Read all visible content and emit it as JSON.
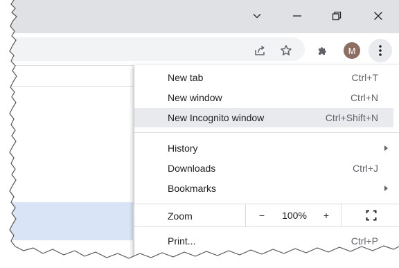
{
  "window": {
    "controls": [
      "tab-search-icon",
      "minimize-icon",
      "restore-icon",
      "close-icon"
    ]
  },
  "toolbar": {
    "icons": [
      "share-icon",
      "bookmark-star-icon",
      "extensions-icon"
    ],
    "avatar_letter": "M",
    "menu_icon": "kebab-menu-icon"
  },
  "menu": {
    "items": [
      {
        "label": "New tab",
        "shortcut": "Ctrl+T"
      },
      {
        "label": "New window",
        "shortcut": "Ctrl+N"
      },
      {
        "label": "New Incognito window",
        "shortcut": "Ctrl+Shift+N",
        "highlighted": true
      },
      {
        "label": "History",
        "submenu": true
      },
      {
        "label": "Downloads",
        "shortcut": "Ctrl+J"
      },
      {
        "label": "Bookmarks",
        "submenu": true
      },
      {
        "label": "Print...",
        "shortcut": "Ctrl+P"
      }
    ],
    "zoom": {
      "label": "Zoom",
      "minus": "−",
      "value": "100%",
      "plus": "+",
      "fullscreen_icon": "fullscreen-icon"
    }
  },
  "colors": {
    "titlebar": "#dfe1e5",
    "highlight": "#e8eaed",
    "page_selection": "#d9e4f7",
    "avatar": "#8d6e63"
  }
}
